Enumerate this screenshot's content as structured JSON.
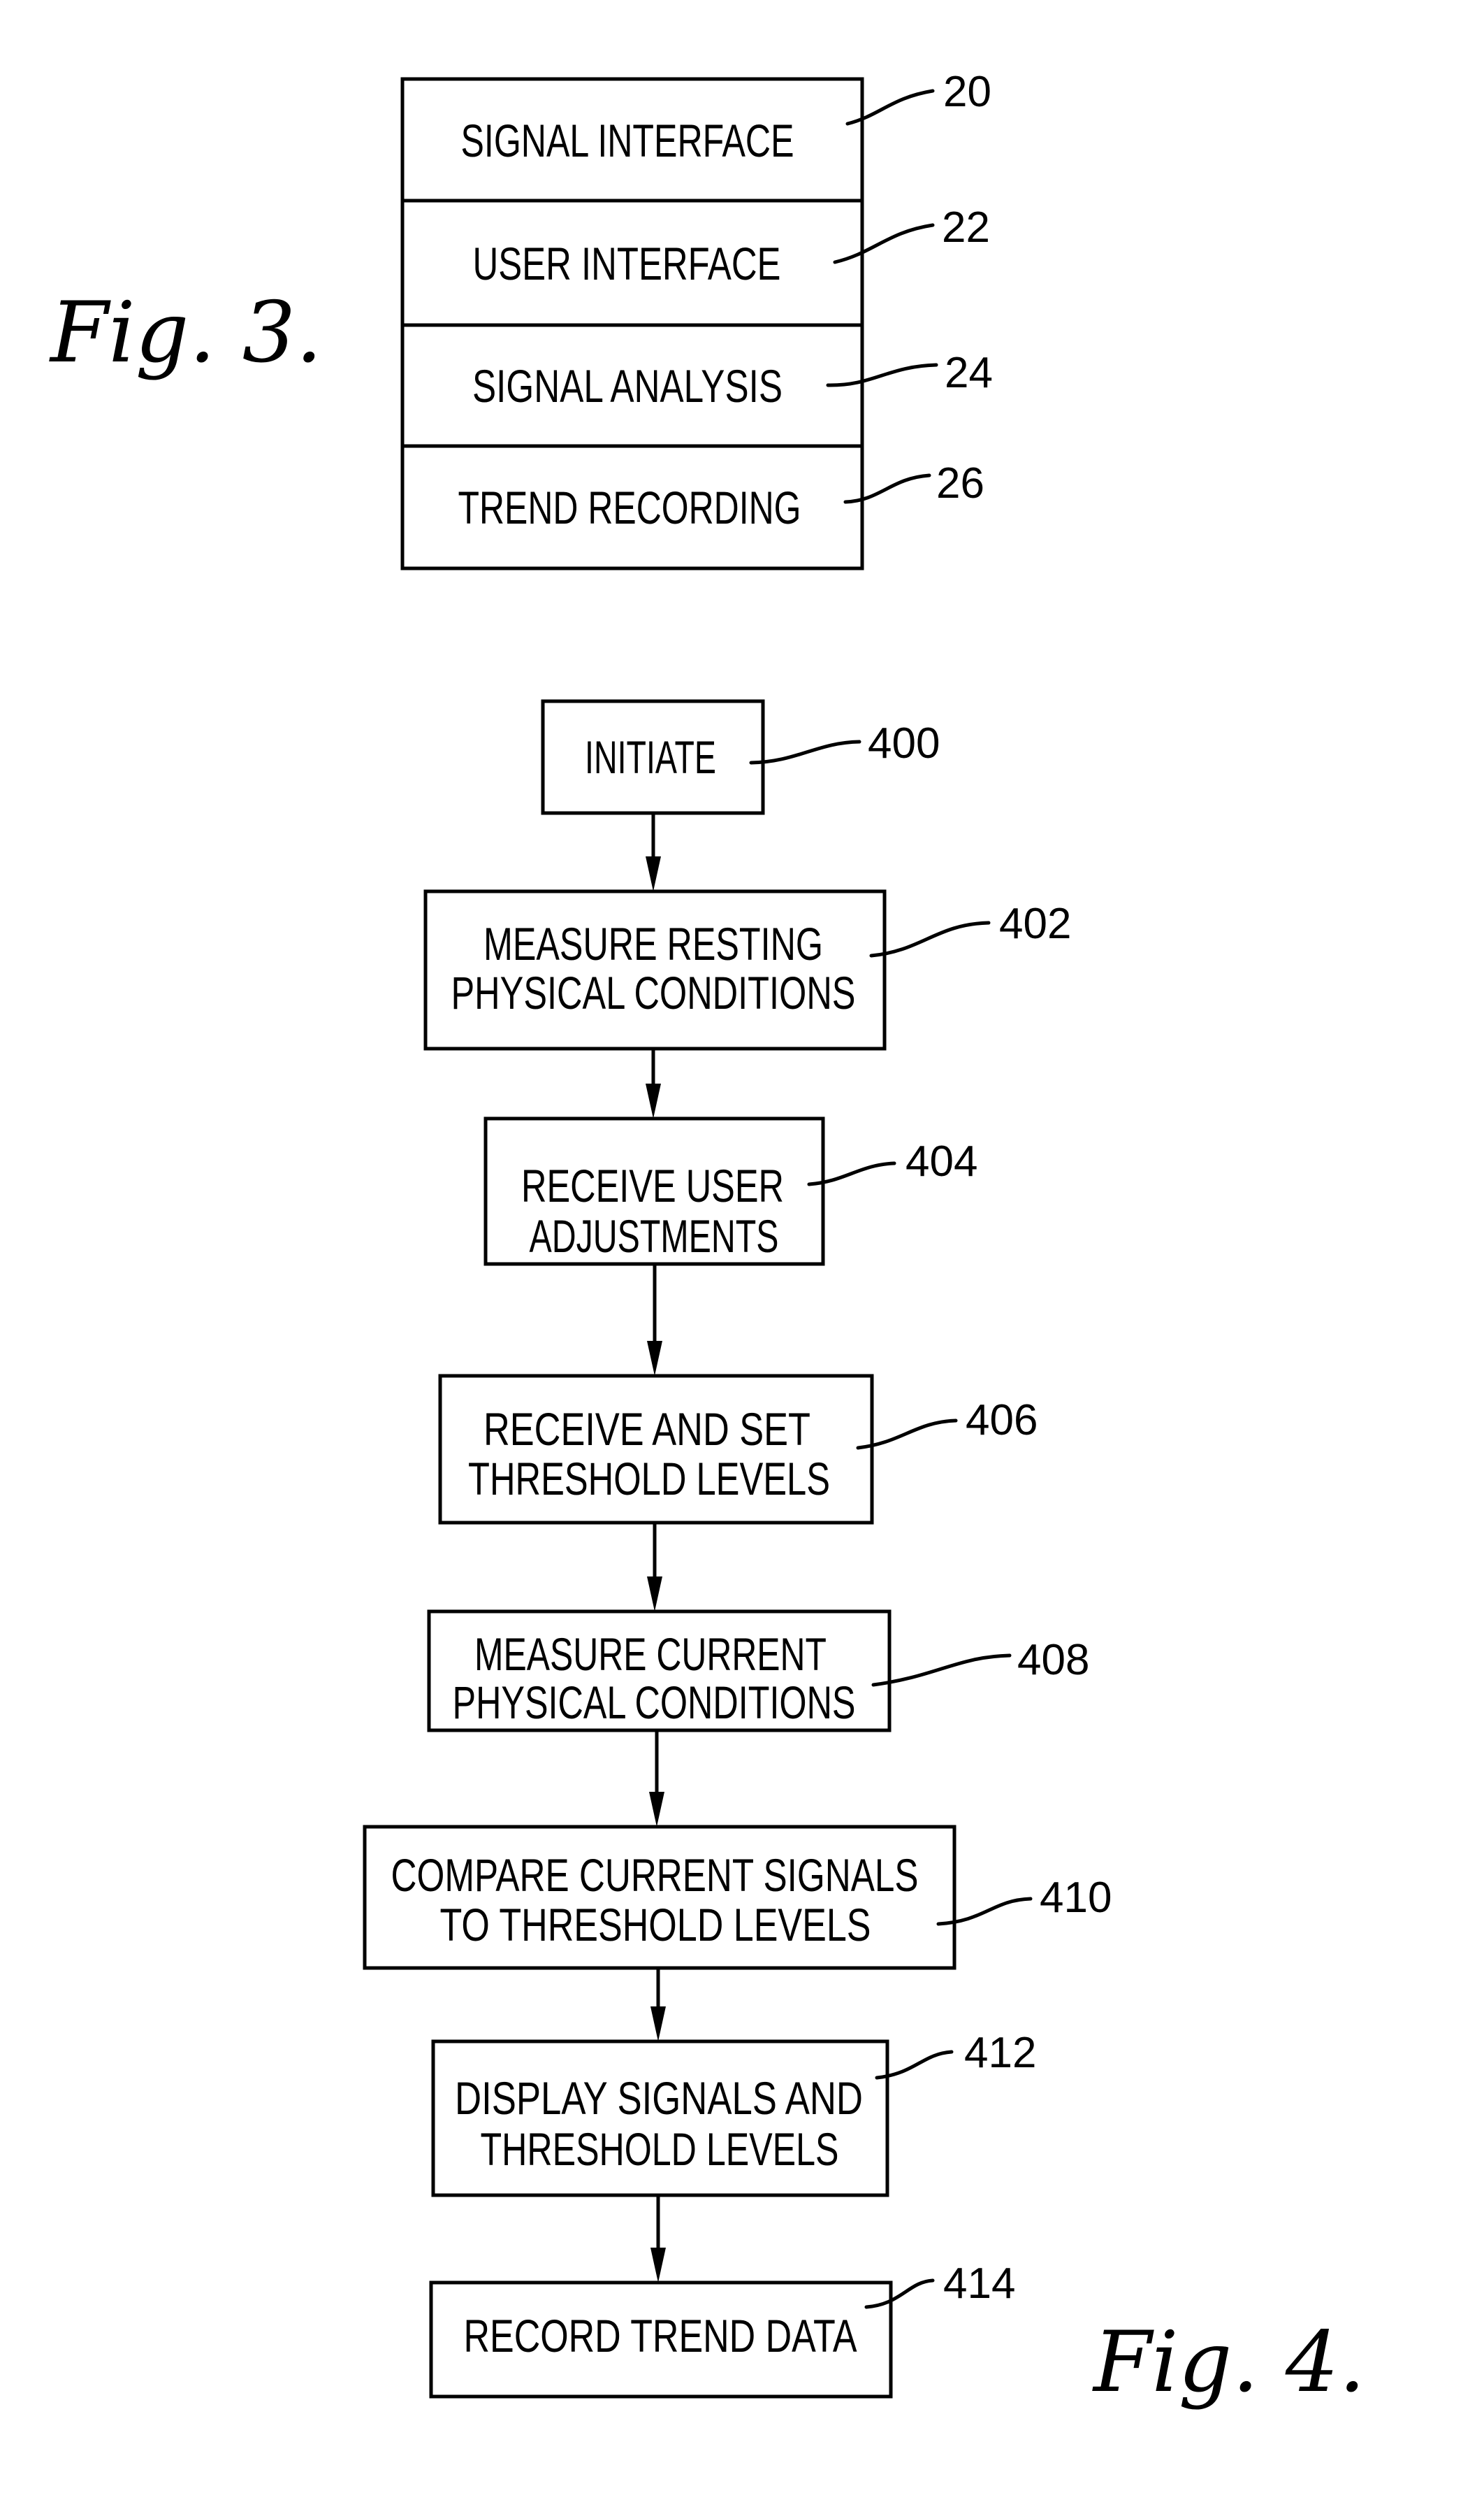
{
  "figure3": {
    "caption": "Fig. 3.",
    "modules": [
      {
        "label": "SIGNAL INTERFACE",
        "ref": "20"
      },
      {
        "label": "USER INTERFACE",
        "ref": "22"
      },
      {
        "label": "SIGNAL ANALYSIS",
        "ref": "24"
      },
      {
        "label": "TREND RECORDING",
        "ref": "26"
      }
    ]
  },
  "figure4": {
    "caption": "Fig. 4.",
    "steps": [
      {
        "ref": "400",
        "lines": [
          "INITIATE"
        ]
      },
      {
        "ref": "402",
        "lines": [
          "MEASURE RESTING",
          "PHYSICAL CONDITIONS"
        ]
      },
      {
        "ref": "404",
        "lines": [
          "RECEIVE USER",
          "ADJUSTMENTS"
        ]
      },
      {
        "ref": "406",
        "lines": [
          "RECEIVE AND SET",
          "THRESHOLD LEVELS"
        ]
      },
      {
        "ref": "408",
        "lines": [
          "MEASURE CURRENT",
          "PHYSICAL CONDITIONS"
        ]
      },
      {
        "ref": "410",
        "lines": [
          "COMPARE CURRENT SIGNALS",
          "TO THRESHOLD LEVELS"
        ]
      },
      {
        "ref": "412",
        "lines": [
          "DISPLAY SIGNALS AND",
          "THRESHOLD LEVELS"
        ]
      },
      {
        "ref": "414",
        "lines": [
          "RECORD TREND DATA"
        ]
      }
    ]
  }
}
